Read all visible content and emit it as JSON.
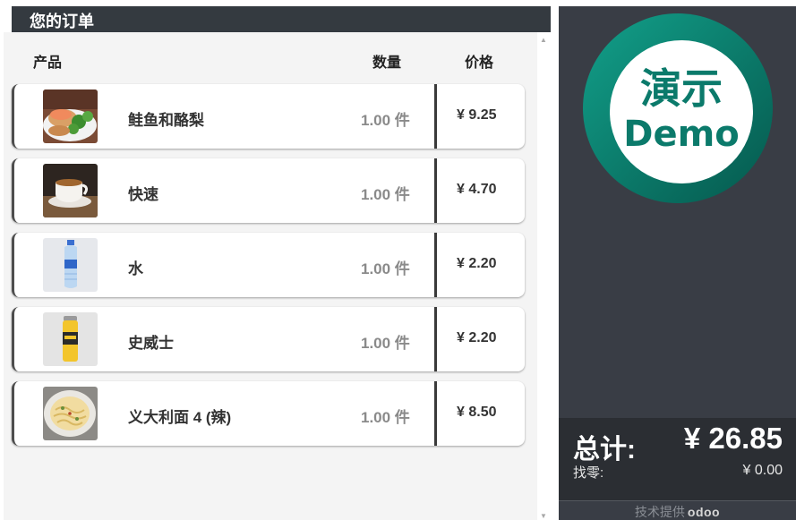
{
  "order": {
    "title": "您的订单",
    "columns": {
      "product": "产品",
      "quantity": "数量",
      "price": "价格"
    },
    "items": [
      {
        "name": "鲑鱼和酪梨",
        "quantity": "1.00 件",
        "price": "¥ 9.25",
        "image": "salmon-avocado-toast"
      },
      {
        "name": "快速",
        "quantity": "1.00 件",
        "price": "¥ 4.70",
        "image": "coffee-cup"
      },
      {
        "name": "水",
        "quantity": "1.00 件",
        "price": "¥ 2.20",
        "image": "water-bottle"
      },
      {
        "name": "史威士",
        "quantity": "1.00 件",
        "price": "¥ 2.20",
        "image": "soda-can"
      },
      {
        "name": "义大利面 4 (辣)",
        "quantity": "1.00 件",
        "price": "¥ 8.50",
        "image": "pasta-bowl"
      }
    ]
  },
  "summary": {
    "total_label": "总计:",
    "total_value": "¥ 26.85",
    "change_label": "找零:",
    "change_value": "¥ 0.00"
  },
  "logo": {
    "line1": "演示",
    "line2": "Demo"
  },
  "footer": {
    "powered_by": "技术提供",
    "brand": "odoo"
  },
  "colors": {
    "header_bg": "#343a40",
    "right_panel_bg": "#393d45",
    "logo_teal": "#0b7a6b"
  }
}
